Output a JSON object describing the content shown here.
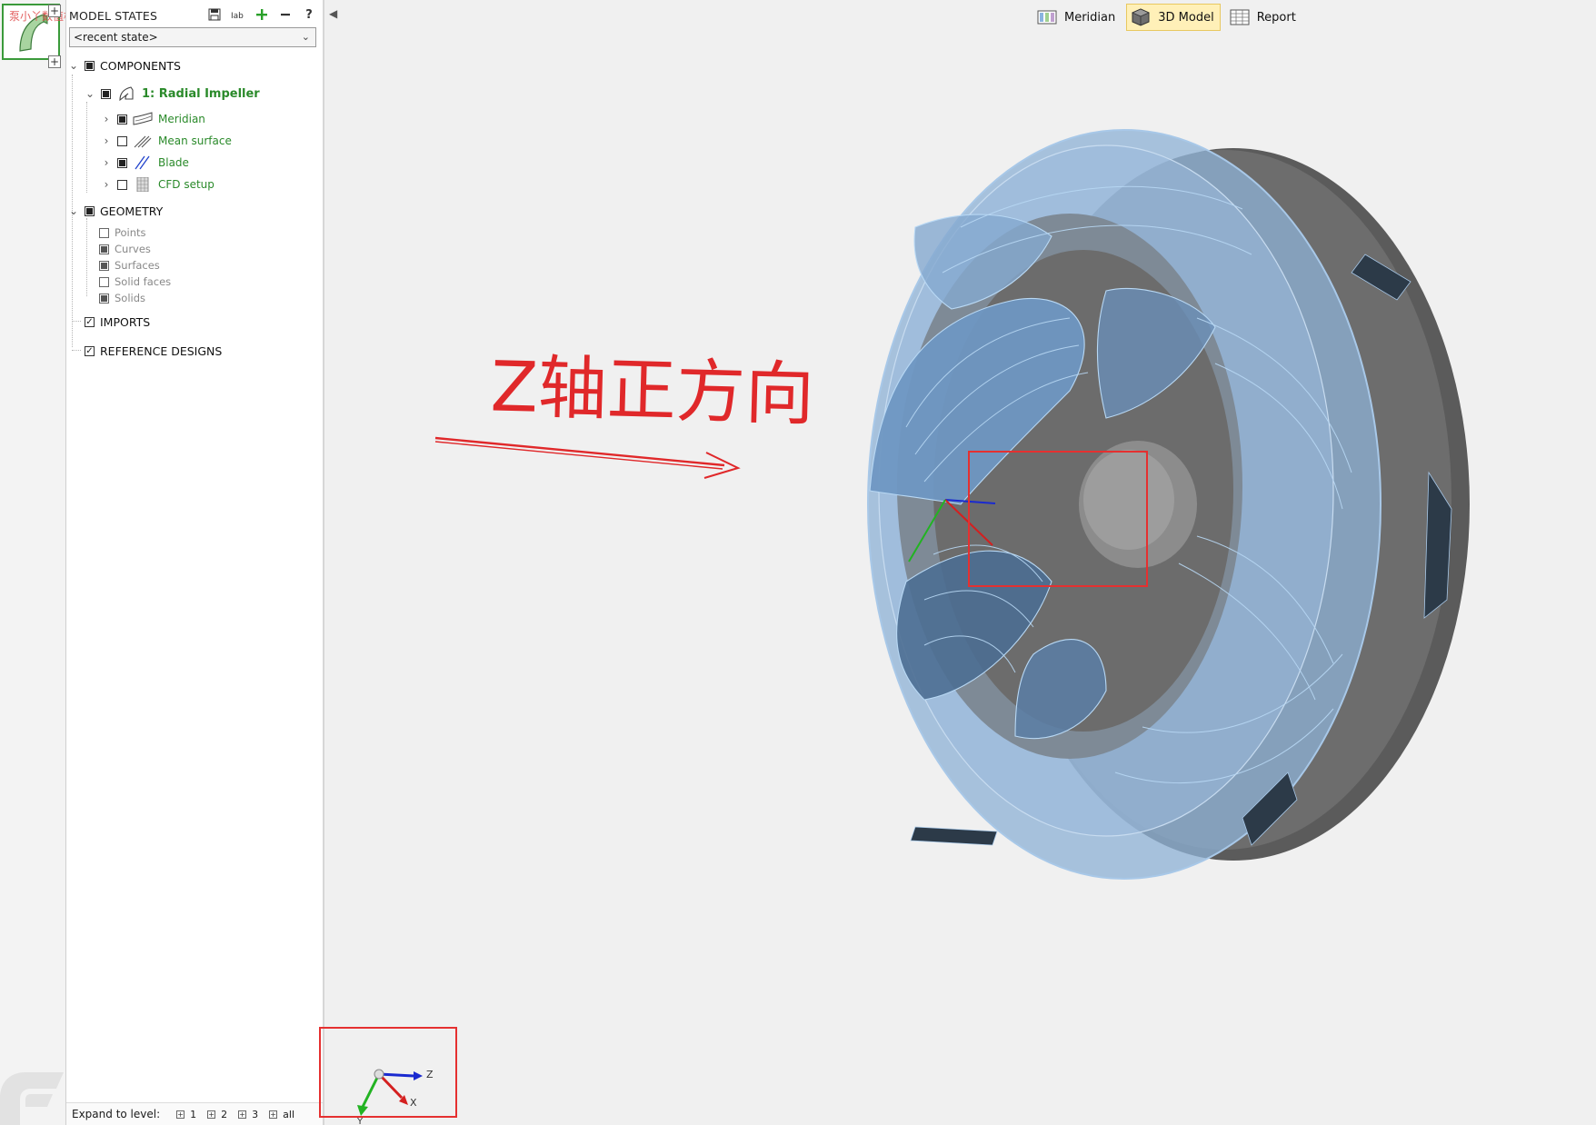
{
  "watermark": "泵小丫数值模拟.cn",
  "thumbnail": {
    "label": "impeller-thumbnail"
  },
  "model_states": {
    "title": "MODEL STATES",
    "tools": [
      "save-state",
      "rename-state",
      "add-state",
      "remove-state",
      "help"
    ],
    "help_label": "?",
    "selected_state": "<recent state>"
  },
  "tree": {
    "components": {
      "label": "COMPONENTS",
      "checked": "full"
    },
    "impeller": {
      "label": "1: Radial Impeller",
      "checked": "full"
    },
    "children": [
      {
        "label": "Meridian",
        "checked": "full"
      },
      {
        "label": "Mean surface",
        "checked": "none"
      },
      {
        "label": "Blade",
        "checked": "full"
      },
      {
        "label": "CFD setup",
        "checked": "none"
      }
    ],
    "geometry": {
      "label": "GEOMETRY",
      "checked": "full"
    },
    "geometry_items": [
      {
        "label": "Points",
        "checked": "none"
      },
      {
        "label": "Curves",
        "checked": "full"
      },
      {
        "label": "Surfaces",
        "checked": "full"
      },
      {
        "label": "Solid faces",
        "checked": "none"
      },
      {
        "label": "Solids",
        "checked": "full"
      }
    ],
    "imports": {
      "label": "IMPORTS",
      "checked": "tick"
    },
    "reference_designs": {
      "label": "REFERENCE DESIGNS",
      "checked": "tick"
    }
  },
  "expand_bar": {
    "label": "Expand to level:",
    "levels": [
      "1",
      "2",
      "3",
      "all"
    ]
  },
  "view_tabs": [
    {
      "label": "Meridian",
      "icon": "meridian-view-icon",
      "active": false
    },
    {
      "label": "3D Model",
      "icon": "cube-icon",
      "active": true
    },
    {
      "label": "Report",
      "icon": "table-icon",
      "active": false
    }
  ],
  "annotation": {
    "text": "Z轴正方向",
    "color": "#e0282a"
  },
  "axes": {
    "z_label": "Z",
    "x_label": "X",
    "y_label": "Y",
    "colors": {
      "x": "#d42020",
      "y": "#22b322",
      "z": "#1a2ad0"
    }
  },
  "colors": {
    "accent_green": "#2a8a2a",
    "active_tab": "#fff0b8",
    "impeller_blue": "#8eb2d6",
    "highlight_red": "#e53030"
  }
}
